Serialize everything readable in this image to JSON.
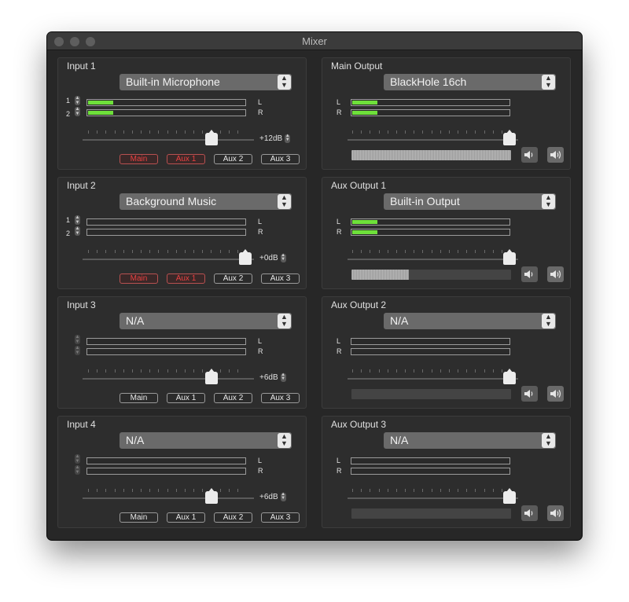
{
  "window": {
    "title": "Mixer"
  },
  "inputs": [
    {
      "title": "Input 1",
      "device": "Built-in Microphone",
      "ch1": "1",
      "ch2": "2",
      "levels": [
        0.16,
        0.16
      ],
      "gain": "+12dB",
      "slider": 0.75,
      "routes": [
        {
          "label": "Main",
          "on": true
        },
        {
          "label": "Aux 1",
          "on": true
        },
        {
          "label": "Aux 2",
          "on": false
        },
        {
          "label": "Aux 3",
          "on": false
        }
      ]
    },
    {
      "title": "Input 2",
      "device": "Background Music",
      "ch1": "1",
      "ch2": "2",
      "levels": [
        0,
        0
      ],
      "gain": "+0dB",
      "slider": 0.95,
      "routes": [
        {
          "label": "Main",
          "on": true
        },
        {
          "label": "Aux 1",
          "on": true
        },
        {
          "label": "Aux 2",
          "on": false
        },
        {
          "label": "Aux 3",
          "on": false
        }
      ]
    },
    {
      "title": "Input 3",
      "device": "N/A",
      "ch1": "",
      "ch2": "",
      "levels": [
        0,
        0
      ],
      "gain": "+6dB",
      "slider": 0.75,
      "routes": [
        {
          "label": "Main",
          "on": false
        },
        {
          "label": "Aux 1",
          "on": false
        },
        {
          "label": "Aux 2",
          "on": false
        },
        {
          "label": "Aux 3",
          "on": false
        }
      ]
    },
    {
      "title": "Input 4",
      "device": "N/A",
      "ch1": "",
      "ch2": "",
      "levels": [
        0,
        0
      ],
      "gain": "+6dB",
      "slider": 0.75,
      "routes": [
        {
          "label": "Main",
          "on": false
        },
        {
          "label": "Aux 1",
          "on": false
        },
        {
          "label": "Aux 2",
          "on": false
        },
        {
          "label": "Aux 3",
          "on": false
        }
      ]
    }
  ],
  "outputs": [
    {
      "title": "Main Output",
      "device": "BlackHole 16ch",
      "levels": [
        0.16,
        0.16
      ],
      "volume": 1.0
    },
    {
      "title": "Aux Output 1",
      "device": "Built-in Output",
      "levels": [
        0.16,
        0.16
      ],
      "volume": 0.36
    },
    {
      "title": "Aux Output 2",
      "device": "N/A",
      "levels": [
        0,
        0
      ],
      "volume": 0
    },
    {
      "title": "Aux Output 3",
      "device": "N/A",
      "levels": [
        0,
        0
      ],
      "volume": 0
    }
  ],
  "labels": {
    "left": "L",
    "right": "R"
  },
  "colors": {
    "meter_fill": "#6ee03a",
    "route_active": "#e84040",
    "window_bg": "#272727"
  },
  "icons": {
    "mute": "speaker-low-icon",
    "loud": "speaker-high-icon"
  }
}
